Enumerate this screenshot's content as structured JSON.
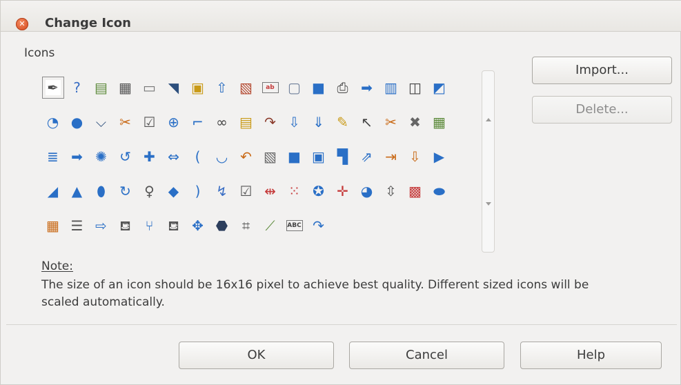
{
  "window": {
    "title": "Change Icon"
  },
  "icons_section": {
    "label": "Icons",
    "selected_index": 0,
    "rows": [
      [
        {
          "name": "pen-icon",
          "glyph": "✒",
          "color": "#4a4a4a"
        },
        {
          "name": "spellcheck-icon",
          "glyph": "?",
          "color": "#3a6ec4"
        },
        {
          "name": "form-check-icon",
          "glyph": "▤",
          "color": "#5c8a3a"
        },
        {
          "name": "calendar-icon",
          "glyph": "▦",
          "color": "#555555"
        },
        {
          "name": "frame-icon",
          "glyph": "▭",
          "color": "#777777"
        },
        {
          "name": "slash-shape-icon",
          "glyph": "◥",
          "color": "#2d4f7d"
        },
        {
          "name": "new-page-icon",
          "glyph": "▣",
          "color": "#c99a17"
        },
        {
          "name": "arrow-up-icon",
          "glyph": "⇧",
          "color": "#2d6fc1"
        },
        {
          "name": "select-frame-icon",
          "glyph": "▧",
          "color": "#b3472e"
        },
        {
          "name": "text-highlight-icon",
          "glyph": "ab",
          "color": "#c53a3a"
        },
        {
          "name": "blank-page-icon",
          "glyph": "▢",
          "color": "#6f7f99"
        },
        {
          "name": "square-icon",
          "glyph": "■",
          "color": "#2a6fc6"
        },
        {
          "name": "printer-icon",
          "glyph": "⎙",
          "color": "#444444"
        },
        {
          "name": "export-icon",
          "glyph": "➡",
          "color": "#2a6fc6"
        },
        {
          "name": "document-stack-icon",
          "glyph": "▥",
          "color": "#2a6fc6"
        },
        {
          "name": "split-icon",
          "glyph": "◫",
          "color": "#444444"
        }
      ],
      [
        {
          "name": "flag-shape-icon",
          "glyph": "◩",
          "color": "#2a6fc6"
        },
        {
          "name": "pie-shape-icon",
          "glyph": "◔",
          "color": "#2a6fc6"
        },
        {
          "name": "circle-icon",
          "glyph": "●",
          "color": "#2a6fc6"
        },
        {
          "name": "chevron-shape-icon",
          "glyph": "⌵",
          "color": "#2d4f7d"
        },
        {
          "name": "cut-page-icon",
          "glyph": "✂",
          "color": "#c96a17"
        },
        {
          "name": "checkbox-icon",
          "glyph": "☑",
          "color": "#555555"
        },
        {
          "name": "lifebuoy-icon",
          "glyph": "⊕",
          "color": "#2a6fc6"
        },
        {
          "name": "step-shape-icon",
          "glyph": "⌐",
          "color": "#2a6fc6"
        },
        {
          "name": "glasses-icon",
          "glyph": "∞",
          "color": "#444444"
        },
        {
          "name": "form-window-icon",
          "glyph": "▤",
          "color": "#c99a17"
        },
        {
          "name": "curved-arrow-icon",
          "glyph": "↷",
          "color": "#8a3a2a"
        },
        {
          "name": "arrow-down-icon",
          "glyph": "⇩",
          "color": "#2a6fc6"
        },
        {
          "name": "arrow-down-alt-icon",
          "glyph": "⇓",
          "color": "#2a6fc6"
        },
        {
          "name": "edit-icon",
          "glyph": "✎",
          "color": "#c99a17"
        },
        {
          "name": "cursor-icon",
          "glyph": "↖",
          "color": "#444444"
        },
        {
          "name": "scissors-icon",
          "glyph": "✂",
          "color": "#c96a17"
        }
      ],
      [
        {
          "name": "tools-icon",
          "glyph": "✖",
          "color": "#666666"
        },
        {
          "name": "table-icon",
          "glyph": "▦",
          "color": "#5c8a3a"
        },
        {
          "name": "sort-text-icon",
          "glyph": "≣",
          "color": "#2a6fc6"
        },
        {
          "name": "arrow-right-icon",
          "glyph": "➡",
          "color": "#2a6fc6"
        },
        {
          "name": "burst-icon",
          "glyph": "✺",
          "color": "#2a6fc6"
        },
        {
          "name": "undo-shape-icon",
          "glyph": "↺",
          "color": "#2a6fc6"
        },
        {
          "name": "cross-shape-icon",
          "glyph": "✚",
          "color": "#2a6fc6"
        },
        {
          "name": "left-right-arrow-icon",
          "glyph": "⇔",
          "color": "#2a6fc6"
        },
        {
          "name": "left-bracket-icon",
          "glyph": "(",
          "color": "#2a6fc6"
        },
        {
          "name": "arc-icon",
          "glyph": "◡",
          "color": "#2a6fc6"
        },
        {
          "name": "u-turn-icon",
          "glyph": "↶",
          "color": "#c96a17"
        },
        {
          "name": "page-cursor-icon",
          "glyph": "▧",
          "color": "#666666"
        },
        {
          "name": "rounded-square-icon",
          "glyph": "■",
          "color": "#2a6fc6"
        },
        {
          "name": "window-icon",
          "glyph": "▣",
          "color": "#2a6fc6"
        },
        {
          "name": "scroll-icon",
          "glyph": "▜",
          "color": "#2a6fc6"
        },
        {
          "name": "arrow-up-right-icon",
          "glyph": "⇗",
          "color": "#2a6fc6"
        }
      ],
      [
        {
          "name": "insert-field-icon",
          "glyph": "⇥",
          "color": "#c96a17"
        },
        {
          "name": "insert-page-icon",
          "glyph": "⇩",
          "color": "#c96a17"
        },
        {
          "name": "pentagon-arrow-icon",
          "glyph": "▶",
          "color": "#2a6fc6"
        },
        {
          "name": "trapezoid-icon",
          "glyph": "◢",
          "color": "#2a6fc6"
        },
        {
          "name": "triangle-icon",
          "glyph": "▲",
          "color": "#2a6fc6"
        },
        {
          "name": "cylinder-icon",
          "glyph": "⬮",
          "color": "#2a6fc6"
        },
        {
          "name": "circular-arrow-icon",
          "glyph": "↻",
          "color": "#2a6fc6"
        },
        {
          "name": "light-bulb-icon",
          "glyph": "♀",
          "color": "#555555"
        },
        {
          "name": "cube-icon",
          "glyph": "◆",
          "color": "#2a6fc6"
        },
        {
          "name": "right-bracket-icon",
          "glyph": ")",
          "color": "#2a6fc6"
        },
        {
          "name": "connector-icon",
          "glyph": "↯",
          "color": "#3a6ec4"
        },
        {
          "name": "checkbox-alt-icon",
          "glyph": "☑",
          "color": "#555555"
        },
        {
          "name": "merge-icon",
          "glyph": "⇹",
          "color": "#c53a3a"
        },
        {
          "name": "grid-dots-icon",
          "glyph": "⁙",
          "color": "#c53a3a"
        },
        {
          "name": "award-icon",
          "glyph": "✪",
          "color": "#2a6fc6"
        },
        {
          "name": "split-cells-icon",
          "glyph": "✛",
          "color": "#c53a3a"
        }
      ],
      [
        {
          "name": "pie-chart-icon",
          "glyph": "◕",
          "color": "#2a6fc6"
        },
        {
          "name": "spin-button-icon",
          "glyph": "⇳",
          "color": "#555555"
        },
        {
          "name": "color-grid-icon",
          "glyph": "▩",
          "color": "#c53a3a"
        },
        {
          "name": "ellipse-icon",
          "glyph": "⬬",
          "color": "#2a6fc6"
        },
        {
          "name": "page-break-icon",
          "glyph": "▦",
          "color": "#c96a17"
        },
        {
          "name": "form-controls-icon",
          "glyph": "☰",
          "color": "#555555"
        },
        {
          "name": "arrow-right-alt-icon",
          "glyph": "⇨",
          "color": "#2a6fc6"
        },
        {
          "name": "paint-bucket-icon",
          "glyph": "⛾",
          "color": "#555555"
        },
        {
          "name": "split-arrow-icon",
          "glyph": "⑂",
          "color": "#2a6fc6"
        },
        {
          "name": "fill-icon",
          "glyph": "⛾",
          "color": "#555555"
        },
        {
          "name": "four-way-arrow-icon",
          "glyph": "✥",
          "color": "#2a6fc6"
        },
        {
          "name": "octagon-icon",
          "glyph": "⬣",
          "color": "#2d3f5d"
        },
        {
          "name": "text-field-icon",
          "glyph": "⌗",
          "color": "#555555"
        },
        {
          "name": "polygon-icon",
          "glyph": "⟋",
          "color": "#5c8a3a"
        },
        {
          "name": "abc-box-icon",
          "glyph": "ABC",
          "color": "#444444"
        },
        {
          "name": "curved-arrow-alt-icon",
          "glyph": "↷",
          "color": "#2a6fc6"
        }
      ]
    ]
  },
  "buttons": {
    "import_label": "Import...",
    "delete_label": "Delete...",
    "ok_label": "OK",
    "cancel_label": "Cancel",
    "help_label": "Help"
  },
  "note": {
    "title": "Note:",
    "text": "The size of an icon should be 16x16 pixel to achieve best quality. Different sized icons will be scaled automatically."
  }
}
